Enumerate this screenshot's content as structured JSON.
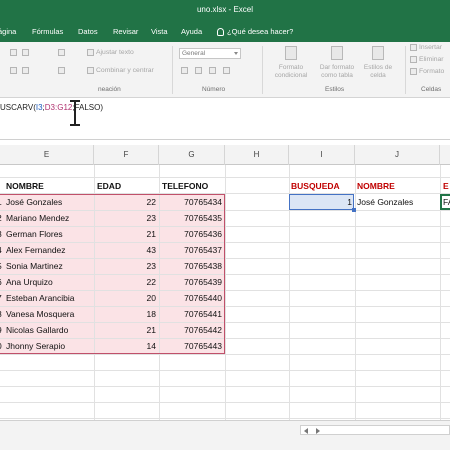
{
  "window": {
    "title": "uno.xlsx  -  Excel"
  },
  "tabs": [
    "ágina",
    "Fórmulas",
    "Datos",
    "Revisar",
    "Vista",
    "Ayuda",
    "¿Qué desea hacer?"
  ],
  "ribbon": {
    "wrap_text": "Ajustar texto",
    "merge_center": "Combinar y centrar",
    "number_format": "General",
    "alignment_group": "neación",
    "number_group": "Número",
    "conditional_format": "Formato condicional",
    "format_as_table": "Dar formato como tabla",
    "cell_styles": "Estilos de celda",
    "styles_group": "Estilos",
    "insert": "Insertar",
    "delete": "Eliminar",
    "format": "Formato",
    "cells_group": "Celdas"
  },
  "formula": {
    "prefix": "USCARV(",
    "ref1": "I3",
    "sep1": ";",
    "ref2": "D3:G12",
    "sep2": ";",
    "suffix": "FALSO)"
  },
  "columns": [
    "E",
    "F",
    "G",
    "H",
    "I",
    "J"
  ],
  "table": {
    "headers": {
      "name": "NOMBRE",
      "age": "EDAD",
      "phone": "TELEFONO"
    },
    "rows": [
      {
        "prefix": "1",
        "name": "José Gonzales",
        "age": "22",
        "phone": "70765434"
      },
      {
        "prefix": "2",
        "name": "Mariano Mendez",
        "age": "23",
        "phone": "70765435"
      },
      {
        "prefix": "3",
        "name": "German Flores",
        "age": "21",
        "phone": "70765436"
      },
      {
        "prefix": "4",
        "name": "Alex Fernandez",
        "age": "43",
        "phone": "70765437"
      },
      {
        "prefix": "5",
        "name": "Sonia Martinez",
        "age": "23",
        "phone": "70765438"
      },
      {
        "prefix": "6",
        "name": "Ana Urquizo",
        "age": "22",
        "phone": "70765439"
      },
      {
        "prefix": "7",
        "name": "Esteban Arancibia",
        "age": "20",
        "phone": "70765440"
      },
      {
        "prefix": "8",
        "name": "Vanesa Mosquera",
        "age": "18",
        "phone": "70765441"
      },
      {
        "prefix": "9",
        "name": "Nicolas Gallardo",
        "age": "21",
        "phone": "70765442"
      },
      {
        "prefix": "0",
        "name": "Jhonny Serapio",
        "age": "14",
        "phone": "70765443"
      }
    ]
  },
  "lookup": {
    "search_header": "BUSQUEDA",
    "name_header": "NOMBRE",
    "extra_header": "E",
    "search_value": "1",
    "result_name": "José Gonzales",
    "extra_value": "FA"
  },
  "colors": {
    "excel_green": "#217346",
    "table_fill": "#fbe3e6",
    "header_red": "#c00000"
  }
}
